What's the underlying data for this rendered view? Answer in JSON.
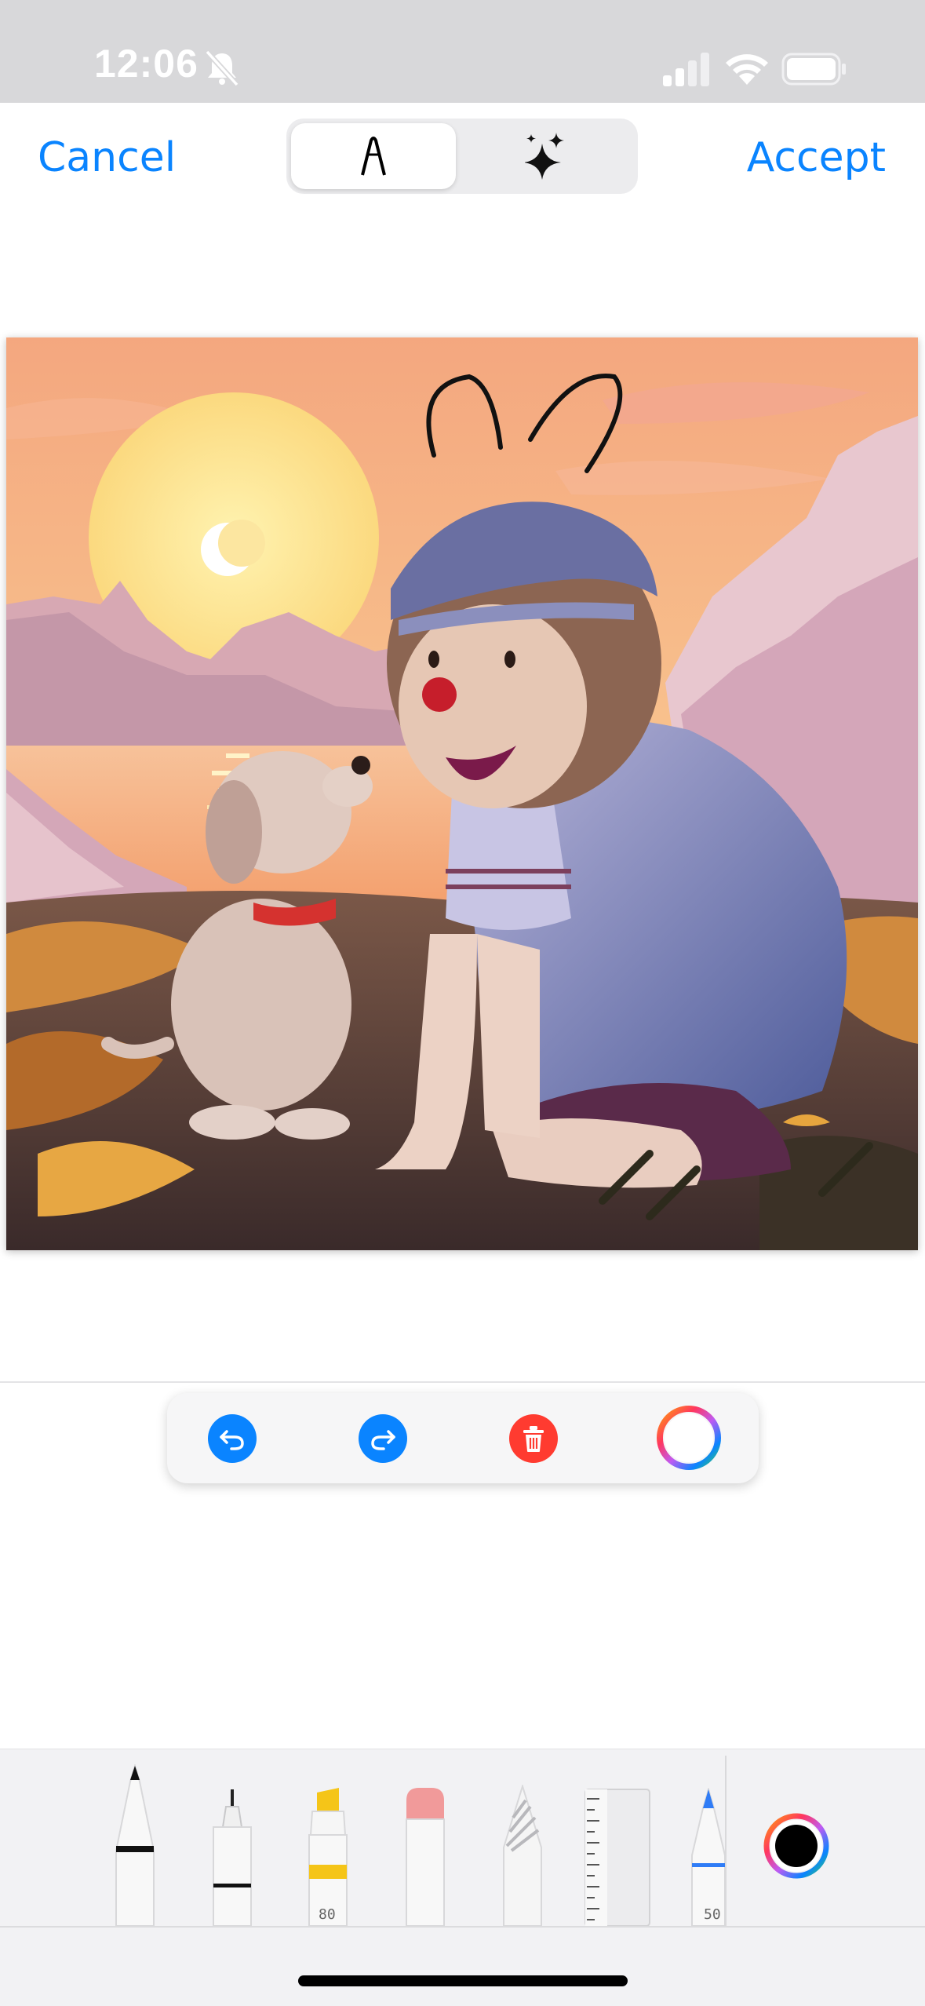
{
  "status_bar": {
    "time": "12:06",
    "icons": [
      "bell-slash-icon",
      "cellular-signal-icon",
      "wifi-icon",
      "battery-icon"
    ]
  },
  "header": {
    "cancel_label": "Cancel",
    "accept_label": "Accept",
    "segments": [
      {
        "icon": "pen-nib-icon",
        "selected": true
      },
      {
        "icon": "sparkles-icon",
        "selected": false
      }
    ]
  },
  "canvas": {
    "description_icon": "edited-photo"
  },
  "actions": [
    {
      "icon": "undo-icon",
      "color": "#0a84ff"
    },
    {
      "icon": "redo-icon",
      "color": "#0a84ff"
    },
    {
      "icon": "trash-icon",
      "color": "#ff3b30"
    },
    {
      "icon": "color-ring-icon"
    }
  ],
  "tools": {
    "items": [
      {
        "name": "pen",
        "icon": "pen-tool-icon"
      },
      {
        "name": "fineliner",
        "icon": "fineliner-tool-icon"
      },
      {
        "name": "highlighter",
        "icon": "highlighter-tool-icon",
        "width_label": "80"
      },
      {
        "name": "eraser",
        "icon": "eraser-tool-icon"
      },
      {
        "name": "lasso",
        "icon": "lasso-tool-icon"
      },
      {
        "name": "ruler",
        "icon": "ruler-tool-icon"
      },
      {
        "name": "crayon",
        "icon": "blue-pen-tool-icon",
        "width_label": "50"
      }
    ],
    "current_color": "#000000"
  },
  "colors": {
    "accent": "#0a84ff",
    "destructive": "#ff3b30"
  }
}
